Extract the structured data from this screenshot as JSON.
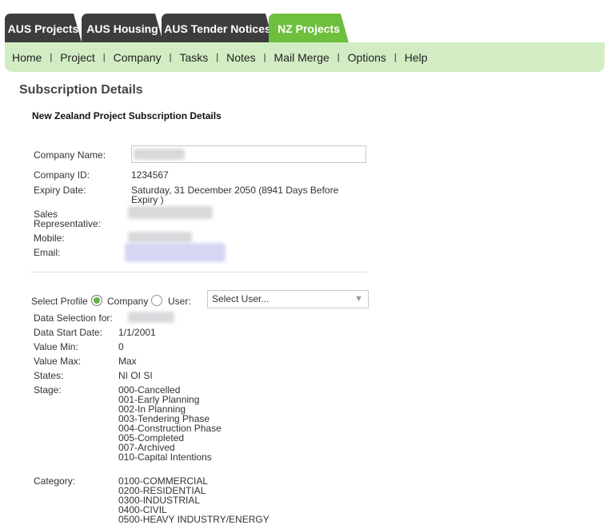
{
  "tabs": [
    {
      "label": "AUS Projects",
      "active": false
    },
    {
      "label": "AUS Housing",
      "active": false
    },
    {
      "label": "AUS Tender Notices",
      "active": false
    },
    {
      "label": "NZ Projects",
      "active": true
    }
  ],
  "nav": [
    "Home",
    "Project",
    "Company",
    "Tasks",
    "Notes",
    "Mail Merge",
    "Options",
    "Help"
  ],
  "nav_separator": "|",
  "page_title": "Subscription Details",
  "section_title": "New Zealand Project Subscription Details",
  "company": {
    "name_label": "Company Name:",
    "id_label": "Company ID:",
    "id_value": "1234567",
    "expiry_label": "Expiry Date:",
    "expiry_value_1": "Saturday, 31 December 2050 (8941 Days Before",
    "expiry_value_2": "Expiry )",
    "rep_label_1": "Sales",
    "rep_label_2": "Representative:",
    "mobile_label": "Mobile:",
    "email_label": "Email:"
  },
  "profile": {
    "select_label": "Select Profile",
    "company_option": "Company",
    "user_option": "User:",
    "user_select_placeholder": "Select User...",
    "selected": "Company"
  },
  "data": {
    "selection_label": "Data Selection for:",
    "start_label": "Data Start Date:",
    "start_value": "1/1/2001",
    "min_label": "Value Min:",
    "min_value": "0",
    "max_label": "Value Max:",
    "max_value": "Max",
    "states_label": "States:",
    "states_value": "NI OI SI",
    "stage_label": "Stage:",
    "stages": [
      "000-Cancelled",
      "001-Early Planning",
      "002-In Planning",
      "003-Tendering Phase",
      "004-Construction Phase",
      "005-Completed",
      "007-Archived",
      "010-Capital Intentions"
    ],
    "category_label": "Category:",
    "categories": [
      "0100-COMMERCIAL",
      "0200-RESIDENTIAL",
      "0300-INDUSTRIAL",
      "0400-CIVIL",
      "0500-HEAVY INDUSTRY/ENERGY"
    ]
  },
  "icons": {
    "select_chevron": "chevron-down-icon"
  },
  "colors": {
    "tab_dark": "#3d3d3d",
    "tab_active": "#6fbf3e",
    "nav_bg": "#d2edc4",
    "radio_checked": "#62b346"
  }
}
